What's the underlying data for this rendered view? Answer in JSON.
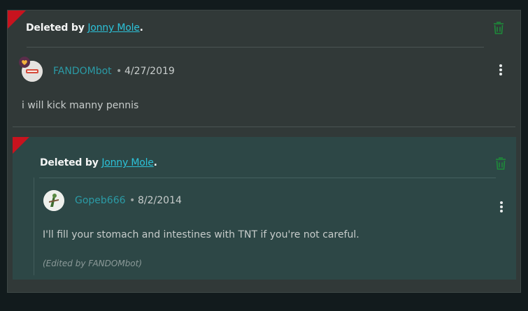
{
  "thread": {
    "deleted_prefix": "Deleted by",
    "deleted_suffix": ".",
    "deleted_by": "Jonny Mole",
    "comment": {
      "author": "FANDOMbot",
      "separator": "•",
      "date": "4/27/2019",
      "body": "i will kick manny pennis",
      "avatar_badge_icon": "heart-icon"
    }
  },
  "reply": {
    "deleted_prefix": "Deleted by",
    "deleted_suffix": ".",
    "deleted_by": "Jonny Mole",
    "author": "Gopeb666",
    "separator": "•",
    "date": "8/2/2014",
    "body": "I'll fill your stomach and intestines with TNT if you're not careful.",
    "edited_note": "(Edited by FANDOMbot)"
  },
  "colors": {
    "background": "#121b1d",
    "card": "#313938",
    "reply_card": "#2d4746",
    "deleted_flag": "#c8131e",
    "link": "#2cc2d9",
    "username": "#2b9ba6",
    "trash_icon": "#1e8a3a"
  },
  "icons": {
    "deleted_flag": "corner-flag-icon",
    "restore": "trash-icon",
    "menu": "kebab-menu-icon"
  }
}
